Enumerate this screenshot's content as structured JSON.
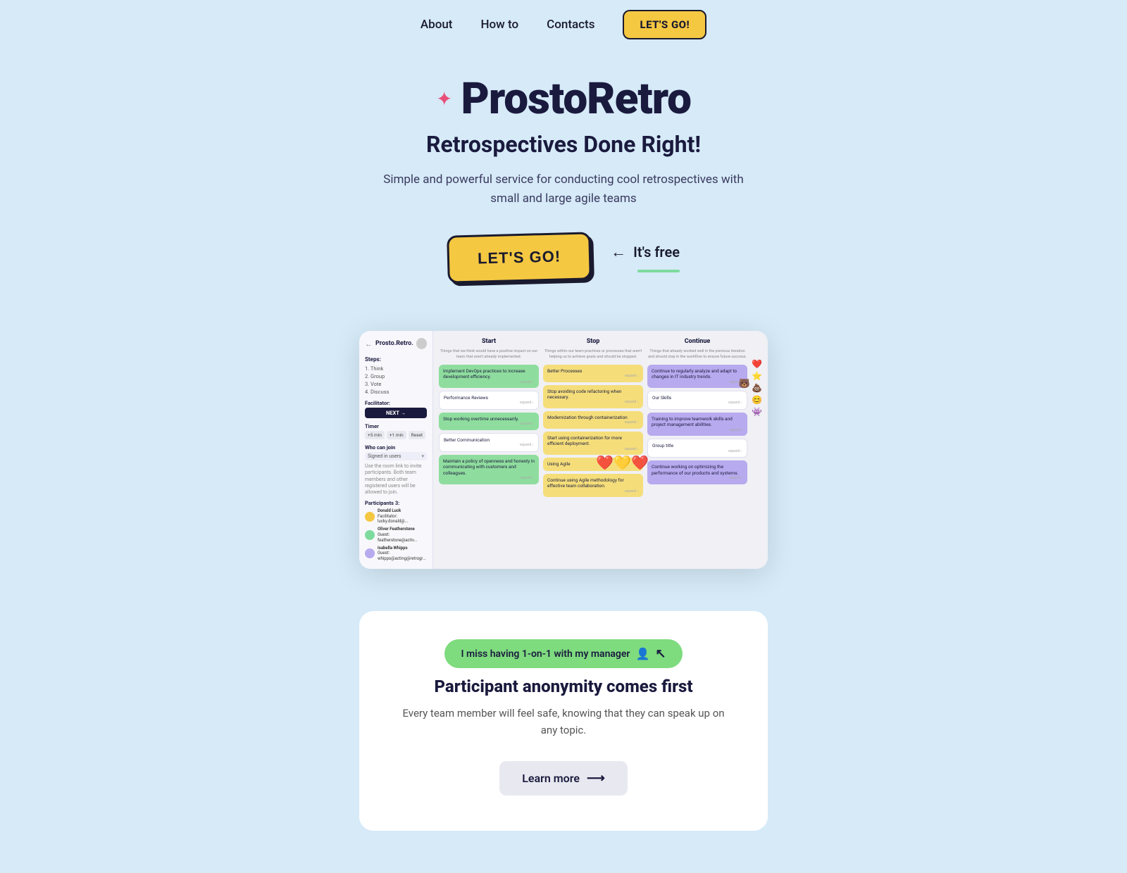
{
  "nav": {
    "about": "About",
    "howto": "How to",
    "contacts": "Contacts",
    "cta": "LET'S GO!"
  },
  "hero": {
    "sparkle": "✦",
    "title": "ProstoRetro",
    "subtitle": "Retrospectives Done Right!",
    "description": "Simple and powerful service for conducting cool retrospectives with small and large agile teams",
    "cta_btn": "LET'S GO!",
    "free_label": "It's free"
  },
  "dashboard": {
    "back": "←",
    "logo": "Prosto.Retro.",
    "steps_label": "Steps:",
    "steps": [
      "1. Think",
      "2. Group",
      "3. Vote",
      "4. Discuss"
    ],
    "facilitator_label": "Facilitator:",
    "next_btn": "NEXT →",
    "timer_label": "Timer",
    "timer_chips": [
      "+5 min",
      "+1 min",
      "Reset"
    ],
    "who_join_label": "Who can join",
    "signed_in": "Signed in users",
    "participants_label": "Participants 3:",
    "participants": [
      {
        "name": "Donald Luck",
        "role": "Facilitator: lucky.donald@..."
      },
      {
        "name": "Oliver Featherstone",
        "role": "Guest: featherstone@activ..."
      },
      {
        "name": "Isabella Whipps",
        "role": "Guest: whipps@acting@retrogr..."
      }
    ],
    "columns": [
      {
        "title": "Start",
        "subtitle": "Things that we think would have a positive impact on our team that aren't already implemented.",
        "cards": [
          {
            "text": "Implement DevOps practices to increase development efficiency.",
            "type": "green"
          },
          {
            "text": "Performance Reviews",
            "type": "white-border"
          },
          {
            "text": "Stop working overtime unnecessarily.",
            "type": "green"
          },
          {
            "text": "Better Communication",
            "type": "white-border"
          },
          {
            "text": "Maintain a policy of openness and honesty in communicating with customers and colleagues.",
            "type": "green"
          }
        ]
      },
      {
        "title": "Stop",
        "subtitle": "Things within our team practices or processes that aren't helping us to achieve goals and should be stopped.",
        "cards": [
          {
            "text": "Better Processes",
            "type": "yellow"
          },
          {
            "text": "Stop avoiding code refactoring when necessary.",
            "type": "yellow"
          },
          {
            "text": "Modernization through containerization",
            "type": "yellow"
          },
          {
            "text": "Start using containerization for more efficient deployment.",
            "type": "yellow"
          },
          {
            "text": "Using Agile",
            "type": "yellow"
          },
          {
            "text": "Continue using Agile methodology for effective team collaboration.",
            "type": "yellow"
          }
        ]
      },
      {
        "title": "Continue",
        "subtitle": "Things that already worked well in the previous iteration and should stay in the workflow to ensure future success.",
        "cards": [
          {
            "text": "Continue to regularly analyze and adapt to changes in IT industry trends.",
            "type": "purple"
          },
          {
            "text": "Our Skills",
            "type": "white-border"
          },
          {
            "text": "Training to improve teamwork skills and project management abilities.",
            "type": "purple"
          },
          {
            "text": "Group title",
            "type": "white-border"
          },
          {
            "text": "Continue working on optimizing the performance of our products and systems.",
            "type": "purple"
          }
        ]
      }
    ]
  },
  "anon": {
    "chip_text": "I miss having 1-on-1 with my manager",
    "title": "Participant anonymity comes first",
    "description": "Every team member will feel safe, knowing that they can speak up on any topic.",
    "learn_more": "Learn more"
  }
}
